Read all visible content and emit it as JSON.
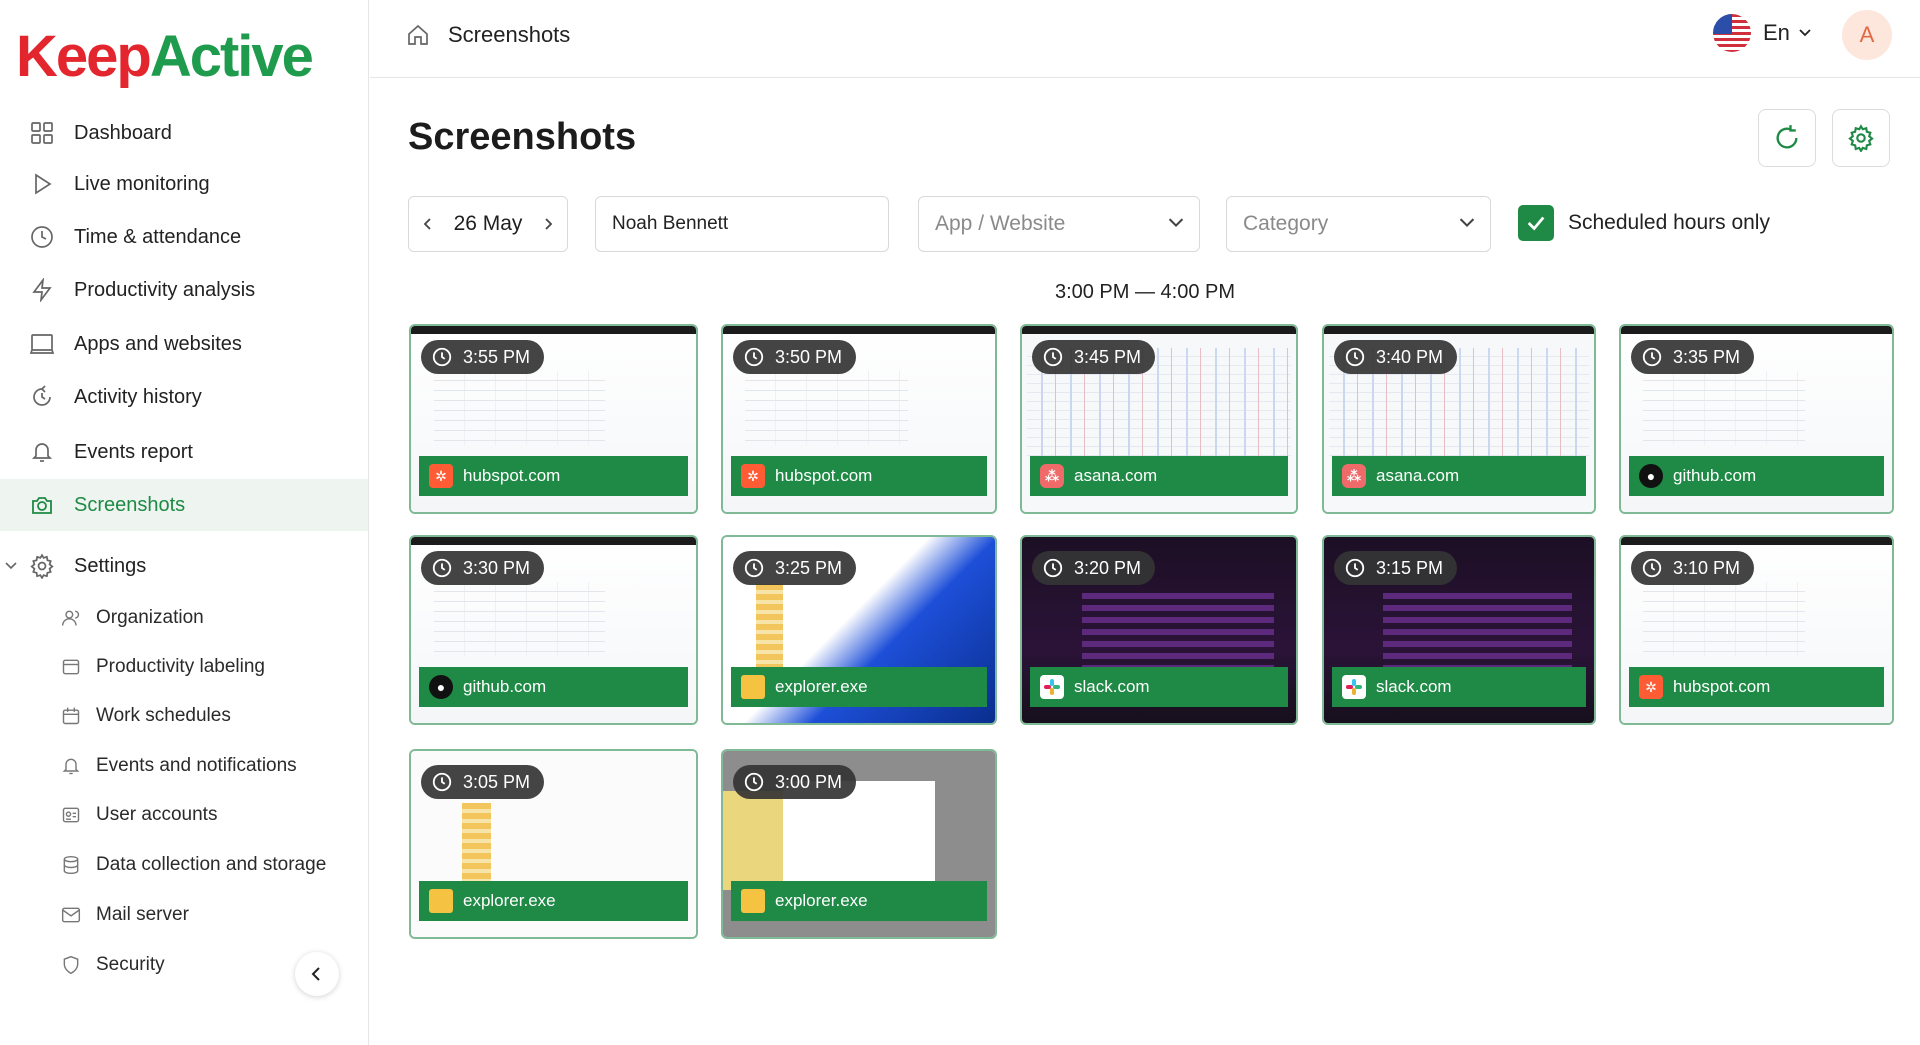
{
  "app": {
    "logo_part1": "Keep",
    "logo_part2": "Active",
    "brand_green": "#1e8a45",
    "brand_red": "#e3262e"
  },
  "sidebar": {
    "items": [
      {
        "label": "Dashboard",
        "icon": "grid-icon"
      },
      {
        "label": "Live monitoring",
        "icon": "play-icon"
      },
      {
        "label": "Time & attendance",
        "icon": "clock-icon"
      },
      {
        "label": "Productivity analysis",
        "icon": "bolt-icon"
      },
      {
        "label": "Apps and websites",
        "icon": "monitor-icon"
      },
      {
        "label": "Activity history",
        "icon": "history-icon"
      },
      {
        "label": "Events report",
        "icon": "bell-icon"
      },
      {
        "label": "Screenshots",
        "icon": "camera-icon",
        "active": true
      }
    ],
    "settings": {
      "label": "Settings",
      "icon": "gear-icon",
      "expanded": true,
      "items": [
        {
          "label": "Organization",
          "icon": "users-icon"
        },
        {
          "label": "Productivity labeling",
          "icon": "tag-icon"
        },
        {
          "label": "Work schedules",
          "icon": "calendar-icon"
        },
        {
          "label": "Events and notifications",
          "icon": "bell-icon"
        },
        {
          "label": "User accounts",
          "icon": "id-card-icon"
        },
        {
          "label": "Data collection and storage",
          "icon": "database-icon"
        },
        {
          "label": "Mail server",
          "icon": "mail-icon"
        },
        {
          "label": "Security",
          "icon": "shield-icon"
        }
      ]
    }
  },
  "header": {
    "breadcrumb": "Screenshots",
    "language": "En",
    "avatar_initial": "A"
  },
  "main": {
    "title": "Screenshots",
    "filters": {
      "date": "26 May",
      "employee": "Noah Bennett",
      "app_placeholder": "App / Website",
      "category_placeholder": "Category",
      "scheduled_only_label": "Scheduled hours only",
      "scheduled_only_checked": true
    },
    "range_label": "3:00 PM — 4:00 PM",
    "screenshots": [
      {
        "time": "3:55 PM",
        "app": "hubspot.com",
        "app_icon": "hubspot"
      },
      {
        "time": "3:50 PM",
        "app": "hubspot.com",
        "app_icon": "hubspot"
      },
      {
        "time": "3:45 PM",
        "app": "asana.com",
        "app_icon": "asana"
      },
      {
        "time": "3:40 PM",
        "app": "asana.com",
        "app_icon": "asana"
      },
      {
        "time": "3:35 PM",
        "app": "github.com",
        "app_icon": "github"
      },
      {
        "time": "3:30 PM",
        "app": "github.com",
        "app_icon": "github"
      },
      {
        "time": "3:25 PM",
        "app": "explorer.exe",
        "app_icon": "explorer"
      },
      {
        "time": "3:20 PM",
        "app": "slack.com",
        "app_icon": "slack"
      },
      {
        "time": "3:15 PM",
        "app": "slack.com",
        "app_icon": "slack"
      },
      {
        "time": "3:10 PM",
        "app": "hubspot.com",
        "app_icon": "hubspot"
      },
      {
        "time": "3:05 PM",
        "app": "explorer.exe",
        "app_icon": "explorer"
      },
      {
        "time": "3:00 PM",
        "app": "explorer.exe",
        "app_icon": "explorer"
      }
    ]
  }
}
